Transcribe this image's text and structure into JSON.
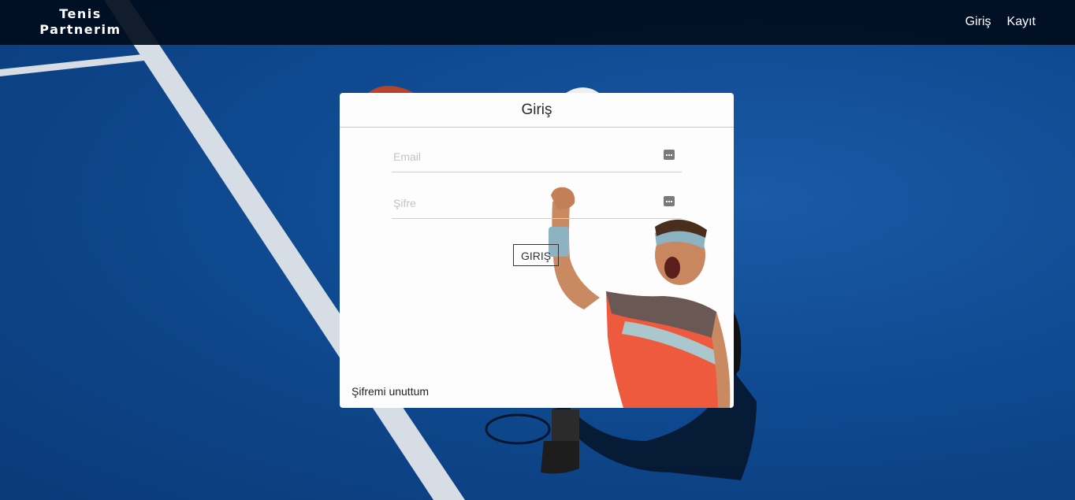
{
  "brand": {
    "line1": "Tenis",
    "line2": "Partnerim"
  },
  "nav": {
    "login": "Giriş",
    "register": "Kayıt"
  },
  "login_card": {
    "title": "Giriş",
    "email_placeholder": "Email",
    "password_placeholder": "Şifre",
    "submit_label": "GIRIŞ",
    "forgot_label": "Şifremi unuttum"
  },
  "colors": {
    "navbar": "#000c1c",
    "court": "#0f4a91",
    "card": "#fdfdfd"
  }
}
